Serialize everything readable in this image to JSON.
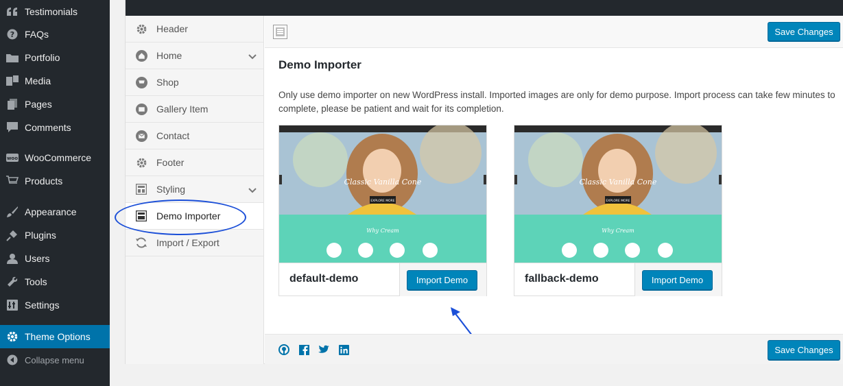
{
  "wp_menu": {
    "items": [
      {
        "label": "Testimonials",
        "icon": "quote-icon"
      },
      {
        "label": "FAQs",
        "icon": "question-icon"
      },
      {
        "label": "Portfolio",
        "icon": "folder-icon"
      },
      {
        "label": "Media",
        "icon": "media-icon"
      },
      {
        "label": "Pages",
        "icon": "pages-icon"
      },
      {
        "label": "Comments",
        "icon": "comment-icon"
      },
      {
        "label": "WooCommerce",
        "icon": "woo-icon"
      },
      {
        "label": "Products",
        "icon": "cart-icon"
      },
      {
        "label": "Appearance",
        "icon": "brush-icon"
      },
      {
        "label": "Plugins",
        "icon": "plug-icon"
      },
      {
        "label": "Users",
        "icon": "user-icon"
      },
      {
        "label": "Tools",
        "icon": "wrench-icon"
      },
      {
        "label": "Settings",
        "icon": "settings-icon"
      },
      {
        "label": "Theme Options",
        "icon": "gear-icon"
      }
    ],
    "collapse_label": "Collapse menu"
  },
  "options_nav": {
    "items": [
      {
        "label": "Header",
        "icon": "gear-icon"
      },
      {
        "label": "Home",
        "icon": "home-icon"
      },
      {
        "label": "Shop",
        "icon": "cart-icon"
      },
      {
        "label": "Gallery Item",
        "icon": "gallery-icon"
      },
      {
        "label": "Contact",
        "icon": "envelope-icon"
      },
      {
        "label": "Footer",
        "icon": "gear-icon"
      },
      {
        "label": "Styling",
        "icon": "styling-icon"
      },
      {
        "label": "Demo Importer",
        "icon": "importer-icon"
      },
      {
        "label": "Import / Export",
        "icon": "refresh-icon"
      }
    ]
  },
  "toolbar": {
    "save_label": "Save Changes"
  },
  "section": {
    "title": "Demo Importer",
    "description": "Only use demo importer on new WordPress install. Imported images are only for demo purpose. Import process can take few minutes to complete, please be patient and wait for its completion."
  },
  "demos": [
    {
      "name": "default-demo",
      "button": "Import Demo"
    },
    {
      "name": "fallback-demo",
      "button": "Import Demo"
    }
  ],
  "preview": {
    "hero_title": "Classic Vanilla Cone",
    "hero_button": "EXPLORE MORE",
    "section_title": "Why Cream"
  },
  "footer": {
    "save_label": "Save Changes"
  },
  "colors": {
    "accent": "#0085ba",
    "wp_menu_bg": "#23282d",
    "active_menu": "#0073aa",
    "callout": "#1b4fd8",
    "teal": "#5dd3b8"
  }
}
